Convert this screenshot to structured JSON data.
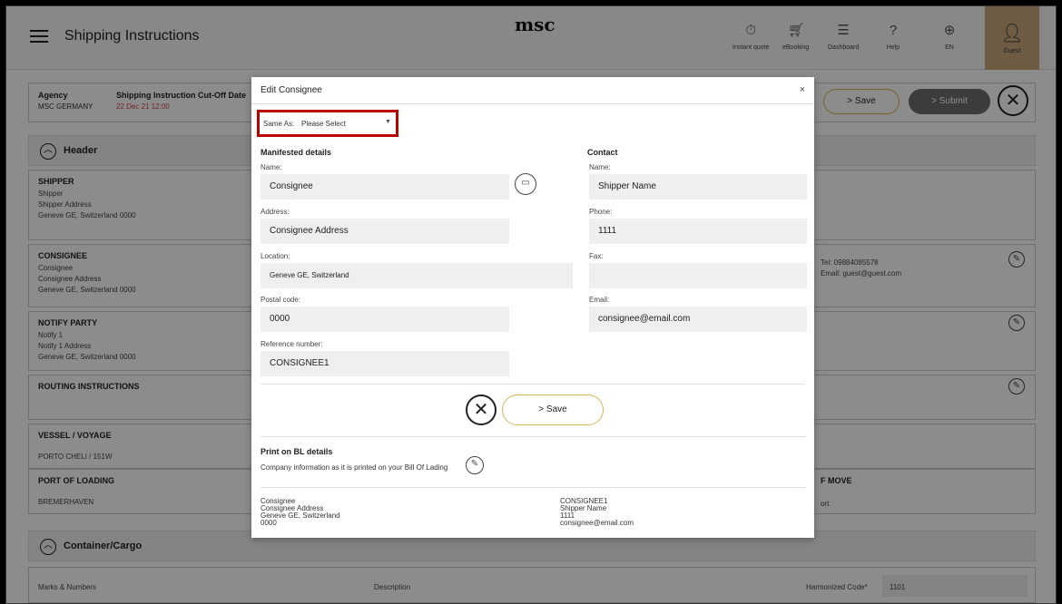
{
  "app": {
    "title": "Shipping Instructions",
    "logo": "msc"
  },
  "topnav": [
    {
      "icon": "stopwatch-icon",
      "label": "Instant quote"
    },
    {
      "icon": "cart-icon",
      "label": "eBooking"
    },
    {
      "icon": "sliders-icon",
      "label": "Dashboard"
    },
    {
      "icon": "help-icon",
      "label": "Help"
    },
    {
      "icon": "globe-icon",
      "label": "EN"
    }
  ],
  "guest": {
    "label": "Guest"
  },
  "agency": {
    "agency_label": "Agency",
    "agency_value": "MSC GERMANY",
    "cutoff_label": "Shipping Instruction Cut-Off Date",
    "cutoff_value": "22 Dec 21 12:00"
  },
  "actions": {
    "save": "> Save",
    "submit": "> Submit"
  },
  "sections": {
    "header": "Header",
    "container": "Container/Cargo"
  },
  "background": {
    "shipper": {
      "title": "SHIPPER",
      "lines": [
        "Shipper",
        "Shipper Address",
        "Geneve GE, Switzerland 0000"
      ]
    },
    "consignee": {
      "title": "CONSIGNEE",
      "lines": [
        "Consignee",
        "Consignee Address",
        "Geneve GE, Switzerland 0000"
      ]
    },
    "consignee_contact": {
      "tel": "Tel: 09884085578",
      "email": "Email: guest@guest.com"
    },
    "notify": {
      "title": "NOTIFY PARTY",
      "lines": [
        "Notify 1",
        "Notify 1 Address",
        "Geneve GE, Switzerland 0000"
      ]
    },
    "routing": {
      "title": "ROUTING INSTRUCTIONS"
    },
    "vessel": {
      "title": "VESSEL / VOYAGE",
      "value": "PORTO CHELI / 151W"
    },
    "pol": {
      "title": "PORT OF LOADING",
      "value": "BREMERHAVEN"
    },
    "move": {
      "title": "F MOVE",
      "value": "ort"
    },
    "cargo": {
      "marks": "Marks & Numbers",
      "description": "Description",
      "hs_label": "Harmonized Code*",
      "hs_value": "1101"
    }
  },
  "modal": {
    "title": "Edit Consignee",
    "close": "×",
    "same_as": {
      "label": "Same As:",
      "value": "Please Select"
    },
    "manifested_title": "Manifested details",
    "contact_title": "Contact",
    "fields": {
      "name_label": "Name:",
      "name_value": "Consignee",
      "address_label": "Address:",
      "address_value": "Consignee Address",
      "location_label": "Location:",
      "location_value": "Geneve GE, Switzerland",
      "postal_label": "Postal code:",
      "postal_value": "0000",
      "ref_label": "Reference number:",
      "ref_value": "CONSIGNEE1",
      "c_name_label": "Name:",
      "c_name_value": "Shipper Name",
      "phone_label": "Phone:",
      "phone_value": "1111",
      "fax_label": "Fax:",
      "fax_value": "",
      "email_label": "Email:",
      "email_value": "consignee@email.com"
    },
    "save": "> Save",
    "bl": {
      "title": "Print on BL details",
      "subtitle": "Company information as it is printed on your Bill Of Lading",
      "left": [
        "Consignee",
        "Consignee Address",
        "Geneve GE, Switzerland",
        "0000"
      ],
      "right": [
        "CONSIGNEE1",
        "Shipper Name",
        "1111",
        "consignee@email.com"
      ]
    }
  }
}
